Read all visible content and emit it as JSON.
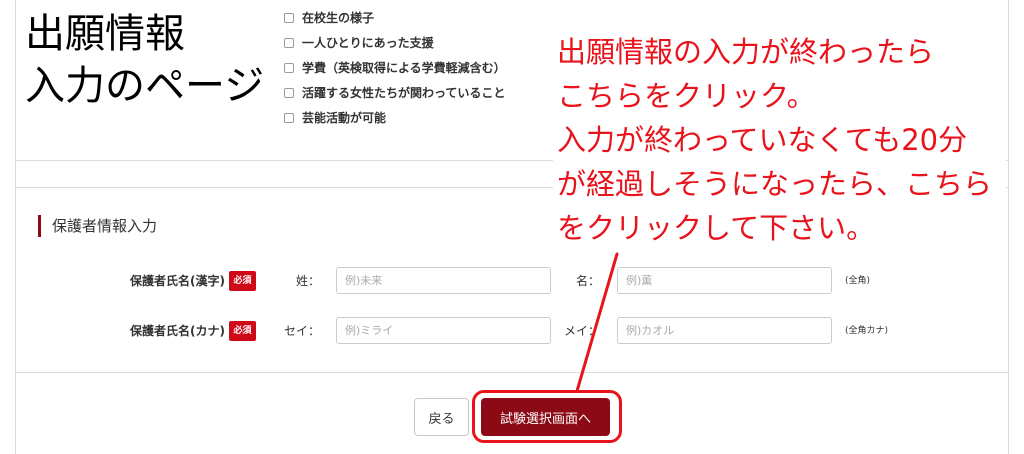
{
  "annotation": {
    "page_title": [
      "出願情報",
      "入力のページ"
    ],
    "callout": [
      "出願情報の入力が終わったら",
      "こちらをクリック。",
      "入力が終わっていなくても20分",
      "が経過しそうになったら、こちら",
      "をクリックして下さい。"
    ]
  },
  "survey": {
    "options": [
      {
        "label": "在校生の様子",
        "checked": false
      },
      {
        "label": "一人ひとりにあった支援",
        "checked": false
      },
      {
        "label": "学費（英検取得による学費軽減含む）",
        "checked": false
      },
      {
        "label": "活躍する女性たちが関わっていること",
        "checked": false
      },
      {
        "label": "芸能活動が可能",
        "checked": false
      }
    ]
  },
  "guardian": {
    "section_title": "保護者情報入力",
    "required_badge": "必須",
    "name_kanji": {
      "label": "保護者氏名(漢字)",
      "family": {
        "label": "姓：",
        "placeholder": "例)未来",
        "value": ""
      },
      "given": {
        "label": "名：",
        "placeholder": "例)薫",
        "value": ""
      },
      "note": "(全角)"
    },
    "name_kana": {
      "label": "保護者氏名(カナ)",
      "family": {
        "label": "セイ：",
        "placeholder": "例)ミライ",
        "value": ""
      },
      "given": {
        "label": "メイ：",
        "placeholder": "例)カオル",
        "value": ""
      },
      "note": "(全角カナ)"
    }
  },
  "actions": {
    "back_label": "戻る",
    "next_label": "試験選択画面へ"
  },
  "colors": {
    "accent": "#8c0a16",
    "required_badge": "#cf0a18",
    "annotation_red": "#e8131b"
  }
}
